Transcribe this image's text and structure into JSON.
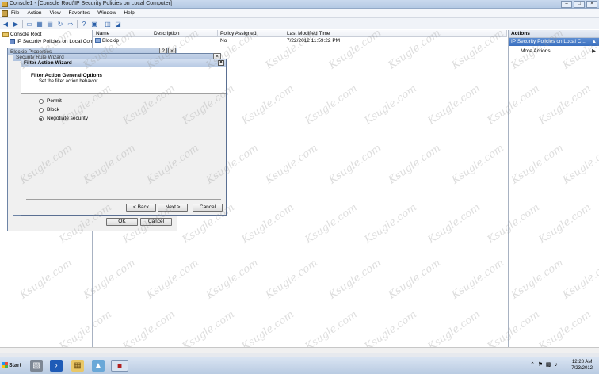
{
  "window": {
    "title": "Console1 - [Console Root\\IP Security Policies on Local Computer]",
    "controls": {
      "minimize": "–",
      "maximize": "□",
      "close": "×"
    }
  },
  "menu": [
    "File",
    "Action",
    "View",
    "Favorites",
    "Window",
    "Help"
  ],
  "tree": {
    "root": "Console Root",
    "child": "IP Security Policies on Local Compute"
  },
  "list": {
    "columns": [
      "Name",
      "Description",
      "Policy Assigned",
      "Last Modified Time"
    ],
    "rows": [
      {
        "name": "Blockip",
        "description": "",
        "assigned": "No",
        "modified": "7/22/2012 11:59:22 PM"
      }
    ]
  },
  "actions": {
    "header": "Actions",
    "selected": "IP Security Policies on Local C...",
    "more": "More Actions"
  },
  "dialogs": {
    "properties_title": "Blockip Properties",
    "rule_wizard_title": "Security Rule Wizard",
    "ok": "OK",
    "cancel": "Cancel",
    "help": "?",
    "close": "×"
  },
  "wizard": {
    "title": "Filter Action Wizard",
    "heading": "Filter Action General Options",
    "subheading": "Set the filter action behavior.",
    "options": [
      "Permit",
      "Block",
      "Negotiate security"
    ],
    "selected_index": 2,
    "back": "< Back",
    "next": "Next >",
    "cancel": "Cancel"
  },
  "watermark": "Ksugle.com",
  "taskbar": {
    "start": "Start",
    "time": "12:28 AM",
    "date": "7/23/2012"
  }
}
